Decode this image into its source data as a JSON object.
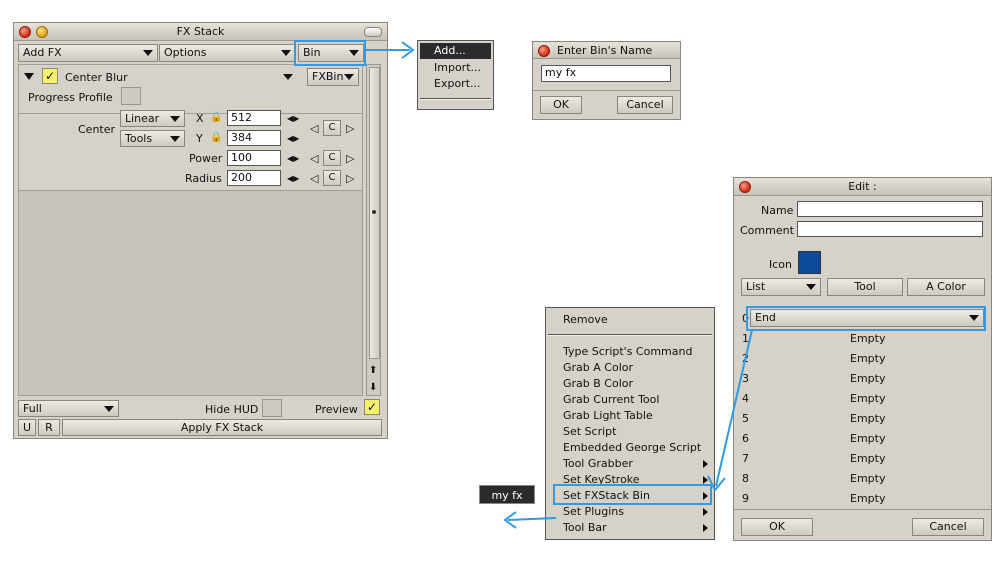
{
  "fx_stack": {
    "title": "FX Stack",
    "add_fx": "Add FX",
    "options": "Options",
    "bin": "Bin",
    "effect_name": "Center Blur",
    "fxbin": "FXBin",
    "progress_profile": "Progress Profile",
    "center_label": "Center",
    "linear": "Linear",
    "tools": "Tools",
    "x_label": "X",
    "x_value": "512",
    "y_label": "Y",
    "y_value": "384",
    "power_label": "Power",
    "power_value": "100",
    "radius_label": "Radius",
    "radius_value": "200",
    "c_label": "C",
    "full": "Full",
    "hide_hud": "Hide HUD",
    "preview": "Preview",
    "u": "U",
    "r": "R",
    "apply": "Apply FX Stack",
    "check_glyph": "✓"
  },
  "bin_menu": {
    "items": [
      "Add...",
      "Import...",
      "Export..."
    ]
  },
  "bin_name_dialog": {
    "title": "Enter Bin's Name",
    "value": "my fx",
    "ok": "OK",
    "cancel": "Cancel"
  },
  "context_menu": {
    "remove": "Remove",
    "items": [
      "Type Script's Command",
      "Grab A Color",
      "Grab B Color",
      "Grab Current Tool",
      "Grab Light Table",
      "Set Script",
      "Embedded George Script",
      "Tool Grabber",
      "Set KeyStroke",
      "Set FXStack Bin",
      "Set Plugins",
      "Tool Bar"
    ],
    "submenu_flags": [
      false,
      false,
      false,
      false,
      false,
      false,
      false,
      true,
      true,
      true,
      true,
      true
    ]
  },
  "edit_dialog": {
    "title": "Edit :",
    "name_label": "Name",
    "comment_label": "Comment",
    "icon_label": "Icon",
    "icon_color": "#0d4a97",
    "list": "List",
    "tool": "Tool",
    "a_color": "A Color",
    "slot0_index": "0",
    "slot0_value": "End",
    "rows": [
      {
        "index": "1",
        "value": "Empty"
      },
      {
        "index": "2",
        "value": "Empty"
      },
      {
        "index": "3",
        "value": "Empty"
      },
      {
        "index": "4",
        "value": "Empty"
      },
      {
        "index": "5",
        "value": "Empty"
      },
      {
        "index": "6",
        "value": "Empty"
      },
      {
        "index": "7",
        "value": "Empty"
      },
      {
        "index": "8",
        "value": "Empty"
      },
      {
        "index": "9",
        "value": "Empty"
      }
    ],
    "ok": "OK",
    "cancel": "Cancel"
  },
  "result_button": "my fx",
  "highlight_color": "#2e9be3"
}
